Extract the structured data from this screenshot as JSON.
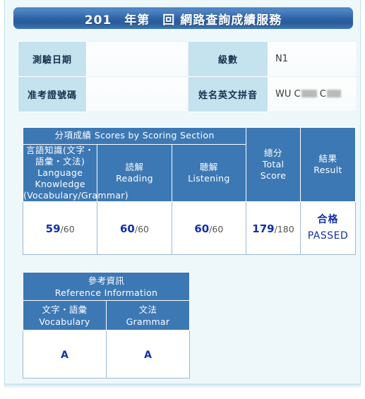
{
  "title": "201　年第　回 網路查詢成績服務",
  "info": {
    "exam_date_label": "測驗日期",
    "exam_date_value": "",
    "level_label": "級數",
    "level_value": "N1",
    "registration_label": "准考證號碼",
    "registration_value": "",
    "name_label": "姓名英文拼音",
    "name_value": "WU C",
    "name_value_2": "C"
  },
  "scores": {
    "group_header_jp": "分項成績",
    "group_header_en": "Scores by Scoring Section",
    "columns": [
      {
        "jp": "言語知識(文字・語彙・文法)",
        "en": "Language Knowledge",
        "en2": "(Vocabulary/Grammar)",
        "score": "59",
        "max": "/60"
      },
      {
        "jp": "読解",
        "en": "Reading",
        "score": "60",
        "max": "/60"
      },
      {
        "jp": "聴解",
        "en": "Listening",
        "score": "60",
        "max": "/60"
      }
    ],
    "total": {
      "jp": "總分",
      "en": "Total",
      "en2": "Score",
      "score": "179",
      "max": "/180"
    },
    "result": {
      "jp": "結果",
      "en": "Result",
      "value_jp": "合格",
      "value_en": "PASSED"
    }
  },
  "reference": {
    "group_header_jp": "參考資訊",
    "group_header_en": "Reference Information",
    "columns": [
      {
        "jp": "文字・語彙",
        "en": "Vocabulary",
        "grade": "A"
      },
      {
        "jp": "文法",
        "en": "Grammar",
        "grade": "A"
      }
    ]
  },
  "colors": {
    "title_bar_blue": "#2f63a4",
    "table_header_blue": "#3c78b4",
    "info_header_blue": "#c5e2ef",
    "score_text_blue": "#1230a8",
    "page_background": "#eef8fb"
  }
}
